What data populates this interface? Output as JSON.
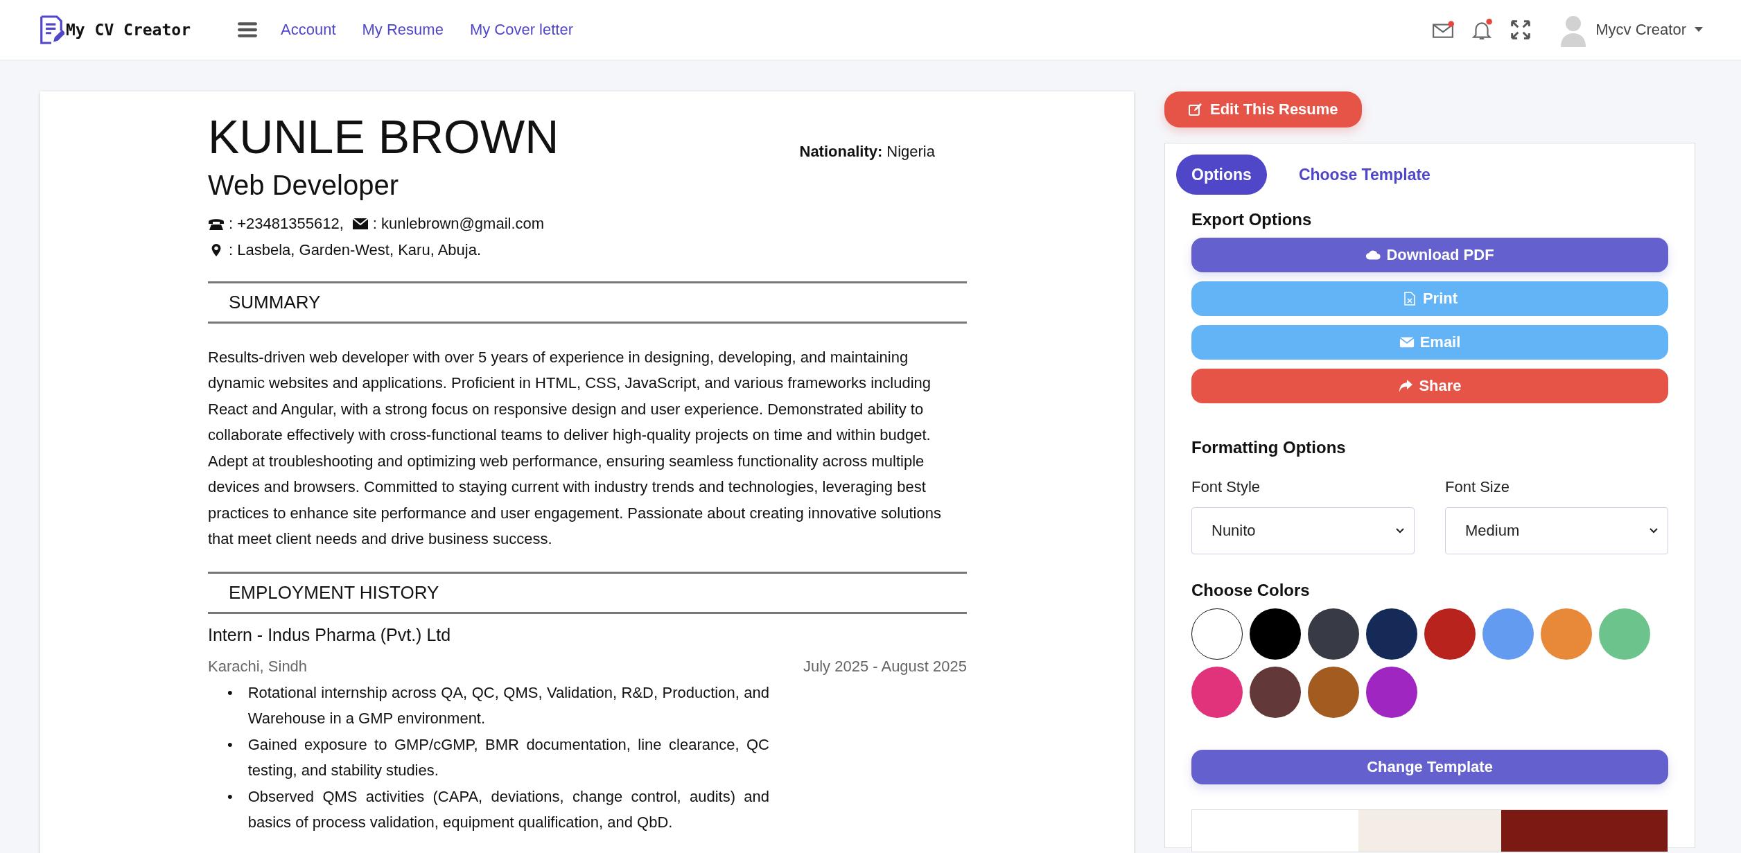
{
  "header": {
    "logo_text": "My CV Creator",
    "nav": [
      "Account",
      "My Resume",
      "My Cover letter"
    ],
    "notifications": [
      {
        "kind": "mail",
        "has_badge": true
      },
      {
        "kind": "bell",
        "has_badge": true
      }
    ],
    "user_name": "Mycv Creator"
  },
  "resume": {
    "name": "KUNLE BROWN",
    "title": "Web Developer",
    "nationality": {
      "label": "Nationality:",
      "value": "Nigeria"
    },
    "phone": ": +23481355612,",
    "email": ": kunlebrown@gmail.com",
    "address": ": Lasbela, Garden-West, Karu, Abuja.",
    "summary": {
      "heading": "SUMMARY",
      "text": "Results-driven web developer with over 5 years of experience in designing, developing, and maintaining dynamic websites and applications. Proficient in HTML, CSS, JavaScript, and various frameworks including React and Angular, with a strong focus on responsive design and user experience. Demonstrated ability to collaborate effectively with cross-functional teams to deliver high-quality projects on time and within budget. Adept at troubleshooting and optimizing web performance, ensuring seamless functionality across multiple devices and browsers. Committed to staying current with industry trends and technologies, leveraging best practices to enhance site performance and user engagement. Passionate about creating innovative solutions that meet client needs and drive business success."
    },
    "employment": {
      "heading": "EMPLOYMENT HISTORY",
      "jobs": [
        {
          "title": "Intern - Indus Pharma (Pvt.) Ltd",
          "location": "Karachi, Sindh",
          "dates": "July 2025 - August 2025",
          "marker": "•",
          "bullets": [
            "Rotational internship across QA, QC, QMS, Validation, R&D, Production, and Warehouse in a GMP environment.",
            "Gained exposure to GMP/cGMP, BMR documentation, line clearance, QC testing, and stability studies.",
            "Observed QMS activities (CAPA, deviations, change control, audits) and basics of process validation, equipment qualification, and QbD."
          ]
        }
      ]
    }
  },
  "panel": {
    "edit_button": "Edit This Resume",
    "tabs": [
      {
        "label": "Options",
        "selected": true
      },
      {
        "label": "Choose Template",
        "selected": false
      }
    ],
    "export_heading": "Export Options",
    "export_buttons": [
      {
        "label": "Download PDF",
        "kind": "pdf"
      },
      {
        "label": "Print",
        "kind": "print"
      },
      {
        "label": "Email",
        "kind": "email"
      },
      {
        "label": "Share",
        "kind": "share"
      }
    ],
    "formatting_heading": "Formatting Options",
    "font_style": {
      "label": "Font Style",
      "value": "Nunito"
    },
    "font_size": {
      "label": "Font Size",
      "value": "Medium"
    },
    "colors_heading": "Choose Colors",
    "colors": [
      {
        "color": "#ffffff"
      },
      {
        "color": "#000000"
      },
      {
        "color": "#383a46"
      },
      {
        "color": "#152a57"
      },
      {
        "color": "#b8231e"
      },
      {
        "color": "#639bf0"
      },
      {
        "color": "#e8893a"
      },
      {
        "color": "#6cc38c"
      },
      {
        "color": "#e1327c"
      },
      {
        "color": "#633839"
      },
      {
        "color": "#a35c1f"
      },
      {
        "color": "#a026c2"
      }
    ],
    "change_template_button": "Change Template"
  }
}
